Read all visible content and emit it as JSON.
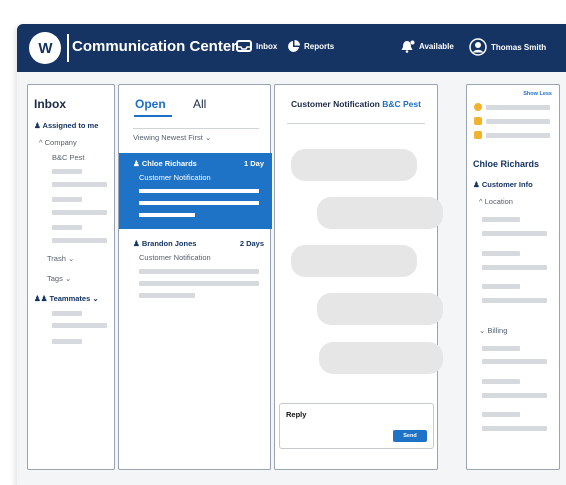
{
  "header": {
    "logo_text": "W",
    "title": "Communication Center",
    "nav": {
      "inbox": "Inbox",
      "reports": "Reports",
      "available": "Available",
      "user": "Thomas Smith"
    }
  },
  "inbox": {
    "title": "Inbox",
    "assigned": "Assigned to me",
    "company": "Company",
    "company_item": "B&C Pest",
    "trash": "Trash",
    "tags": "Tags",
    "teammates": "Teammates"
  },
  "list": {
    "tabs": {
      "open": "Open",
      "all": "All"
    },
    "viewing": "Viewing Newest First",
    "items": [
      {
        "name": "Chloe Richards",
        "age": "1 Day",
        "subject": "Customer Notification"
      },
      {
        "name": "Brandon Jones",
        "age": "2 Days",
        "subject": "Customer Notification"
      }
    ]
  },
  "chat": {
    "header_prefix": "Customer Notification ",
    "header_company": "B&C Pest",
    "reply_label": "Reply",
    "send": "Send"
  },
  "details": {
    "show_less": "Show Less",
    "contact": "Chloe Richards",
    "customer_info": "Customer Info",
    "location": "Location",
    "billing": "Billing"
  },
  "colors": {
    "navy": "#163463",
    "accent": "#1f73c7",
    "placeholder": "#d6d9de"
  }
}
